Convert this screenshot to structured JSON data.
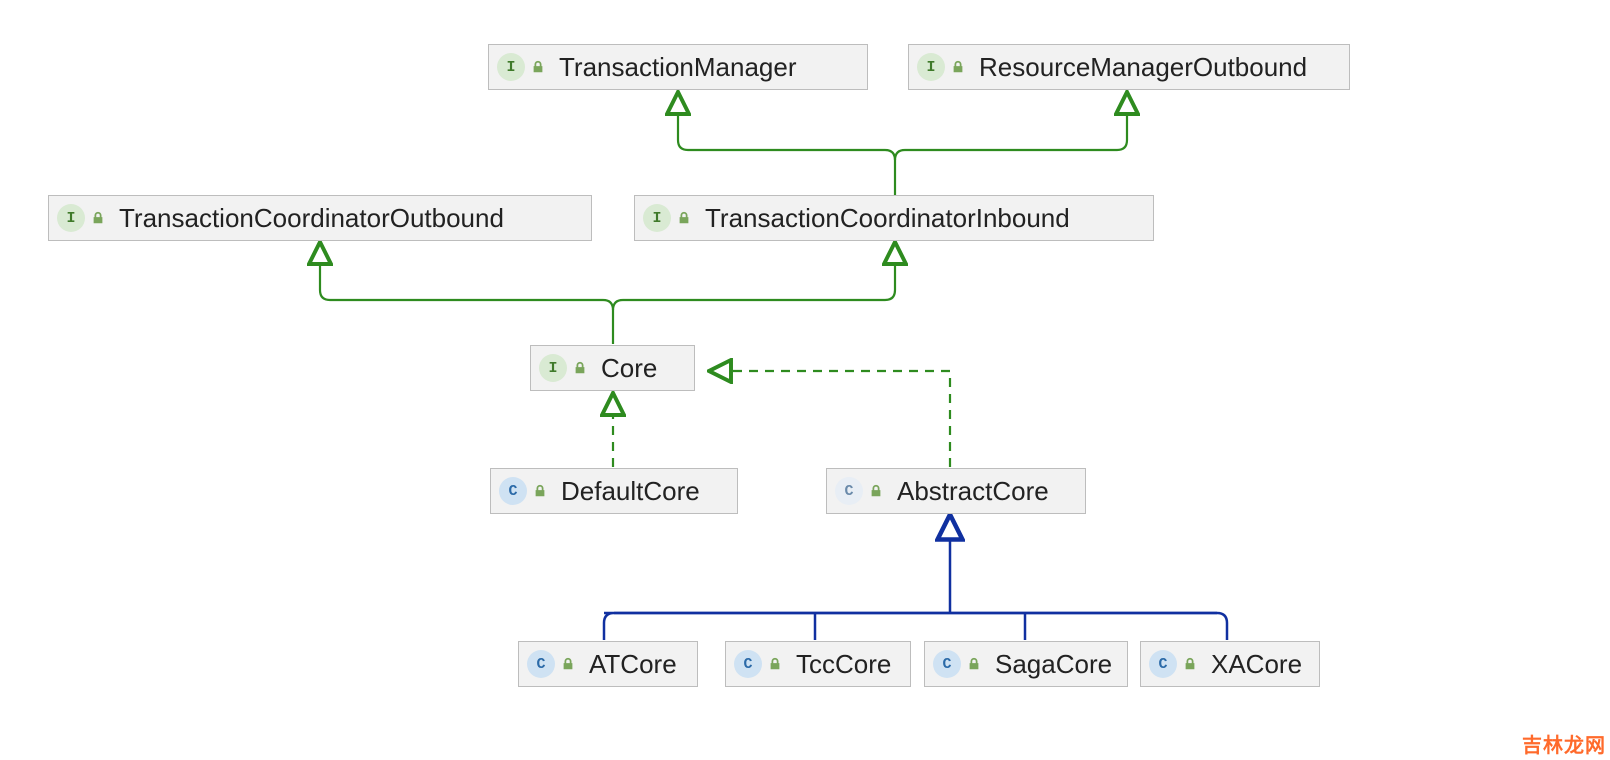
{
  "colors": {
    "interface_bg": "#d9ead3",
    "interface_fg": "#3f7a2a",
    "class_bg": "#cfe2f3",
    "class_fg": "#2b6aa8",
    "node_bg": "#f2f2f2",
    "node_border": "#bdbdbd",
    "lock_fill": "#7aa55b",
    "green_line": "#2e8b1f",
    "blue_line": "#1030a0",
    "watermark": "#ff6a2b"
  },
  "watermark": "吉林龙网",
  "nodes": {
    "tm": {
      "kind": "interface",
      "label": "TransactionManager"
    },
    "rmo": {
      "kind": "interface",
      "label": "ResourceManagerOutbound"
    },
    "tco": {
      "kind": "interface",
      "label": "TransactionCoordinatorOutbound"
    },
    "tci": {
      "kind": "interface",
      "label": "TransactionCoordinatorInbound"
    },
    "core": {
      "kind": "interface",
      "label": "Core"
    },
    "defaultcore": {
      "kind": "class",
      "label": "DefaultCore"
    },
    "abstractcore": {
      "kind": "abstract",
      "label": "AbstractCore"
    },
    "atcore": {
      "kind": "class",
      "label": "ATCore"
    },
    "tcccore": {
      "kind": "class",
      "label": "TccCore"
    },
    "sagacore": {
      "kind": "class",
      "label": "SagaCore"
    },
    "xacore": {
      "kind": "class",
      "label": "XACore"
    }
  },
  "edges": [
    {
      "from": "tci",
      "to": "tm",
      "style": "implements"
    },
    {
      "from": "tci",
      "to": "rmo",
      "style": "implements"
    },
    {
      "from": "core",
      "to": "tco",
      "style": "implements"
    },
    {
      "from": "core",
      "to": "tci",
      "style": "implements"
    },
    {
      "from": "defaultcore",
      "to": "core",
      "style": "realizes"
    },
    {
      "from": "abstractcore",
      "to": "core",
      "style": "realizes"
    },
    {
      "from": "atcore",
      "to": "abstractcore",
      "style": "extends"
    },
    {
      "from": "tcccore",
      "to": "abstractcore",
      "style": "extends"
    },
    {
      "from": "sagacore",
      "to": "abstractcore",
      "style": "extends"
    },
    {
      "from": "xacore",
      "to": "abstractcore",
      "style": "extends"
    }
  ]
}
